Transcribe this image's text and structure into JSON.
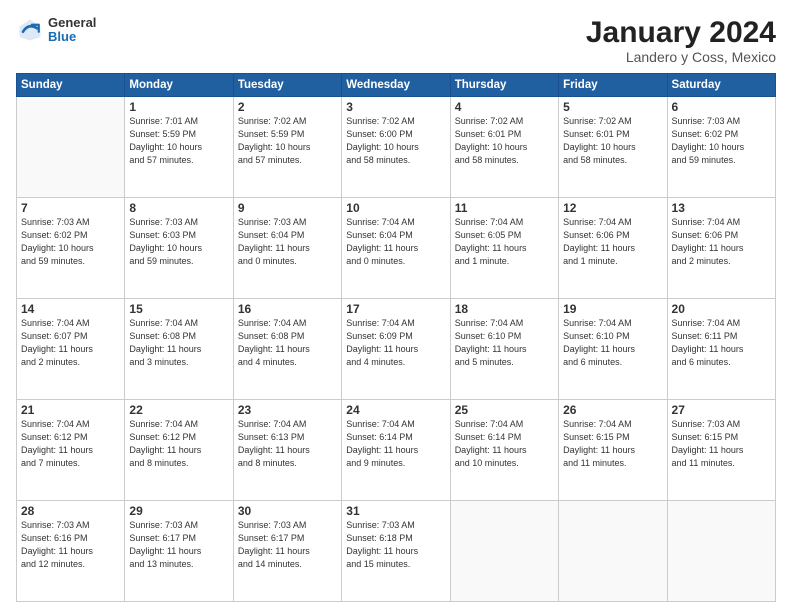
{
  "header": {
    "logo_line1": "General",
    "logo_line2": "Blue",
    "title": "January 2024",
    "subtitle": "Landero y Coss, Mexico"
  },
  "weekdays": [
    "Sunday",
    "Monday",
    "Tuesday",
    "Wednesday",
    "Thursday",
    "Friday",
    "Saturday"
  ],
  "weeks": [
    [
      {
        "day": "",
        "info": ""
      },
      {
        "day": "1",
        "info": "Sunrise: 7:01 AM\nSunset: 5:59 PM\nDaylight: 10 hours\nand 57 minutes."
      },
      {
        "day": "2",
        "info": "Sunrise: 7:02 AM\nSunset: 5:59 PM\nDaylight: 10 hours\nand 57 minutes."
      },
      {
        "day": "3",
        "info": "Sunrise: 7:02 AM\nSunset: 6:00 PM\nDaylight: 10 hours\nand 58 minutes."
      },
      {
        "day": "4",
        "info": "Sunrise: 7:02 AM\nSunset: 6:01 PM\nDaylight: 10 hours\nand 58 minutes."
      },
      {
        "day": "5",
        "info": "Sunrise: 7:02 AM\nSunset: 6:01 PM\nDaylight: 10 hours\nand 58 minutes."
      },
      {
        "day": "6",
        "info": "Sunrise: 7:03 AM\nSunset: 6:02 PM\nDaylight: 10 hours\nand 59 minutes."
      }
    ],
    [
      {
        "day": "7",
        "info": "Sunrise: 7:03 AM\nSunset: 6:02 PM\nDaylight: 10 hours\nand 59 minutes."
      },
      {
        "day": "8",
        "info": "Sunrise: 7:03 AM\nSunset: 6:03 PM\nDaylight: 10 hours\nand 59 minutes."
      },
      {
        "day": "9",
        "info": "Sunrise: 7:03 AM\nSunset: 6:04 PM\nDaylight: 11 hours\nand 0 minutes."
      },
      {
        "day": "10",
        "info": "Sunrise: 7:04 AM\nSunset: 6:04 PM\nDaylight: 11 hours\nand 0 minutes."
      },
      {
        "day": "11",
        "info": "Sunrise: 7:04 AM\nSunset: 6:05 PM\nDaylight: 11 hours\nand 1 minute."
      },
      {
        "day": "12",
        "info": "Sunrise: 7:04 AM\nSunset: 6:06 PM\nDaylight: 11 hours\nand 1 minute."
      },
      {
        "day": "13",
        "info": "Sunrise: 7:04 AM\nSunset: 6:06 PM\nDaylight: 11 hours\nand 2 minutes."
      }
    ],
    [
      {
        "day": "14",
        "info": "Sunrise: 7:04 AM\nSunset: 6:07 PM\nDaylight: 11 hours\nand 2 minutes."
      },
      {
        "day": "15",
        "info": "Sunrise: 7:04 AM\nSunset: 6:08 PM\nDaylight: 11 hours\nand 3 minutes."
      },
      {
        "day": "16",
        "info": "Sunrise: 7:04 AM\nSunset: 6:08 PM\nDaylight: 11 hours\nand 4 minutes."
      },
      {
        "day": "17",
        "info": "Sunrise: 7:04 AM\nSunset: 6:09 PM\nDaylight: 11 hours\nand 4 minutes."
      },
      {
        "day": "18",
        "info": "Sunrise: 7:04 AM\nSunset: 6:10 PM\nDaylight: 11 hours\nand 5 minutes."
      },
      {
        "day": "19",
        "info": "Sunrise: 7:04 AM\nSunset: 6:10 PM\nDaylight: 11 hours\nand 6 minutes."
      },
      {
        "day": "20",
        "info": "Sunrise: 7:04 AM\nSunset: 6:11 PM\nDaylight: 11 hours\nand 6 minutes."
      }
    ],
    [
      {
        "day": "21",
        "info": "Sunrise: 7:04 AM\nSunset: 6:12 PM\nDaylight: 11 hours\nand 7 minutes."
      },
      {
        "day": "22",
        "info": "Sunrise: 7:04 AM\nSunset: 6:12 PM\nDaylight: 11 hours\nand 8 minutes."
      },
      {
        "day": "23",
        "info": "Sunrise: 7:04 AM\nSunset: 6:13 PM\nDaylight: 11 hours\nand 8 minutes."
      },
      {
        "day": "24",
        "info": "Sunrise: 7:04 AM\nSunset: 6:14 PM\nDaylight: 11 hours\nand 9 minutes."
      },
      {
        "day": "25",
        "info": "Sunrise: 7:04 AM\nSunset: 6:14 PM\nDaylight: 11 hours\nand 10 minutes."
      },
      {
        "day": "26",
        "info": "Sunrise: 7:04 AM\nSunset: 6:15 PM\nDaylight: 11 hours\nand 11 minutes."
      },
      {
        "day": "27",
        "info": "Sunrise: 7:03 AM\nSunset: 6:15 PM\nDaylight: 11 hours\nand 11 minutes."
      }
    ],
    [
      {
        "day": "28",
        "info": "Sunrise: 7:03 AM\nSunset: 6:16 PM\nDaylight: 11 hours\nand 12 minutes."
      },
      {
        "day": "29",
        "info": "Sunrise: 7:03 AM\nSunset: 6:17 PM\nDaylight: 11 hours\nand 13 minutes."
      },
      {
        "day": "30",
        "info": "Sunrise: 7:03 AM\nSunset: 6:17 PM\nDaylight: 11 hours\nand 14 minutes."
      },
      {
        "day": "31",
        "info": "Sunrise: 7:03 AM\nSunset: 6:18 PM\nDaylight: 11 hours\nand 15 minutes."
      },
      {
        "day": "",
        "info": ""
      },
      {
        "day": "",
        "info": ""
      },
      {
        "day": "",
        "info": ""
      }
    ]
  ]
}
